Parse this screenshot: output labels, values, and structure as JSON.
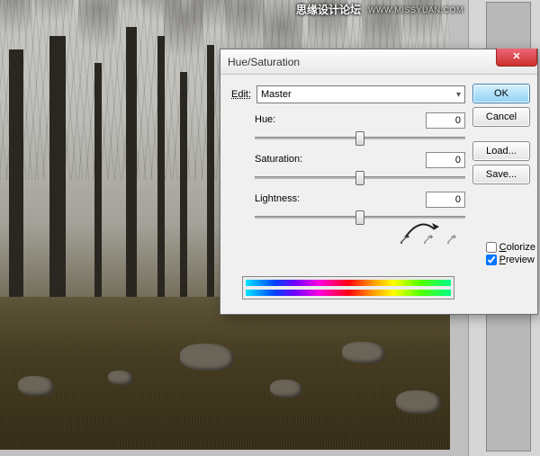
{
  "watermark": {
    "text": "思缘设计论坛",
    "url": "WWW.MISSYUAN.COM"
  },
  "dialog": {
    "title": "Hue/Saturation",
    "edit_label": "Edit:",
    "channel": "Master",
    "sliders": {
      "hue": {
        "label": "Hue:",
        "value": "0"
      },
      "saturation": {
        "label": "Saturation:",
        "value": "0"
      },
      "lightness": {
        "label": "Lightness:",
        "value": "0"
      }
    },
    "buttons": {
      "ok": "OK",
      "cancel": "Cancel",
      "load": "Load...",
      "save": "Save..."
    },
    "colorize_label": "Colorize",
    "preview_label": "Preview",
    "preview_checked": true,
    "colorize_checked": false,
    "close_glyph": "✕"
  }
}
